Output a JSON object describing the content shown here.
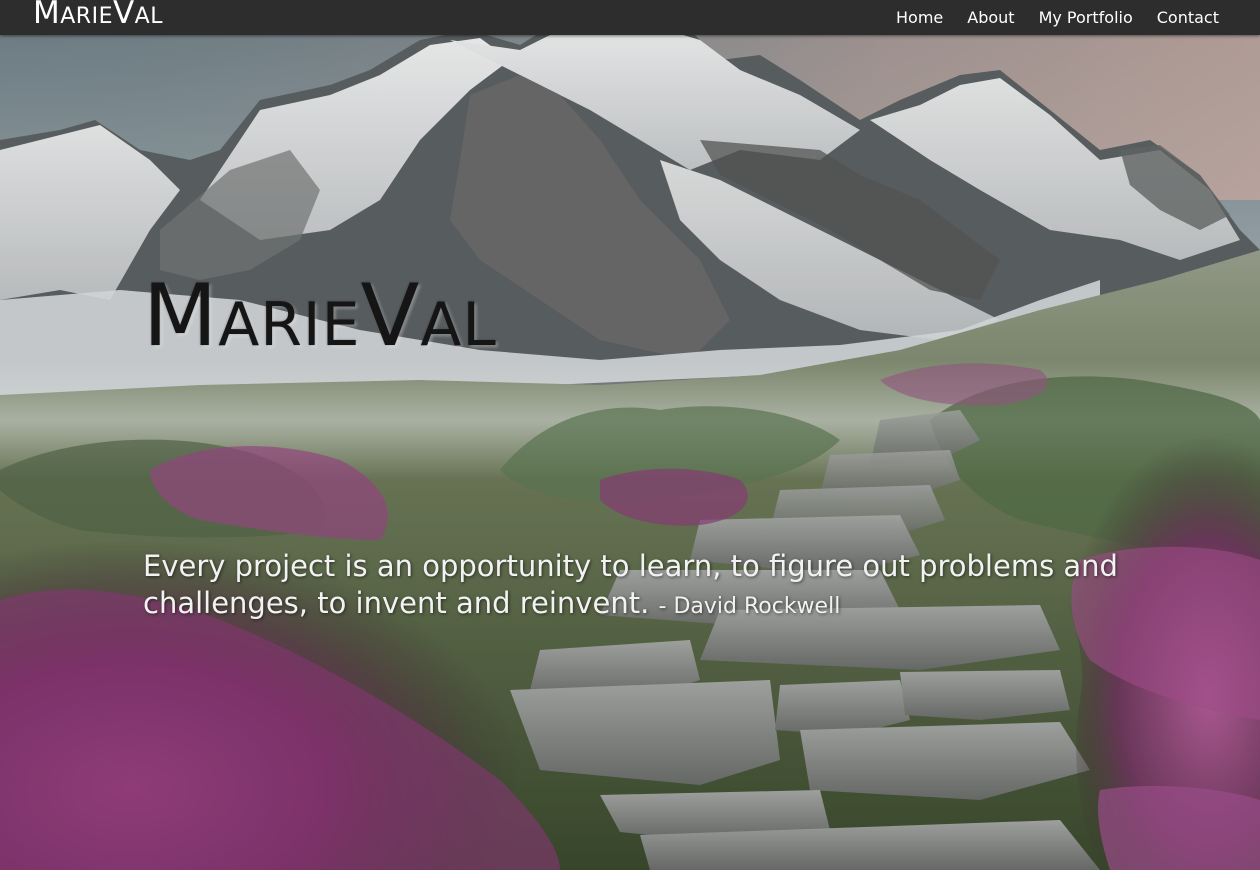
{
  "navbar": {
    "brand": "MarieVal",
    "links": [
      {
        "label": "Home"
      },
      {
        "label": "About"
      },
      {
        "label": "My Portfolio"
      },
      {
        "label": "Contact"
      }
    ]
  },
  "hero": {
    "title": "MarieVal",
    "quote": "Every project is an opportunity to learn, to figure out problems and challenges, to invent and reinvent.",
    "author": "- David Rockwell"
  },
  "colors": {
    "navbar_bg": "#2c2d2c",
    "nav_text": "#ffffff",
    "title_text": "#151515",
    "quote_text": "#f2f2f2"
  }
}
